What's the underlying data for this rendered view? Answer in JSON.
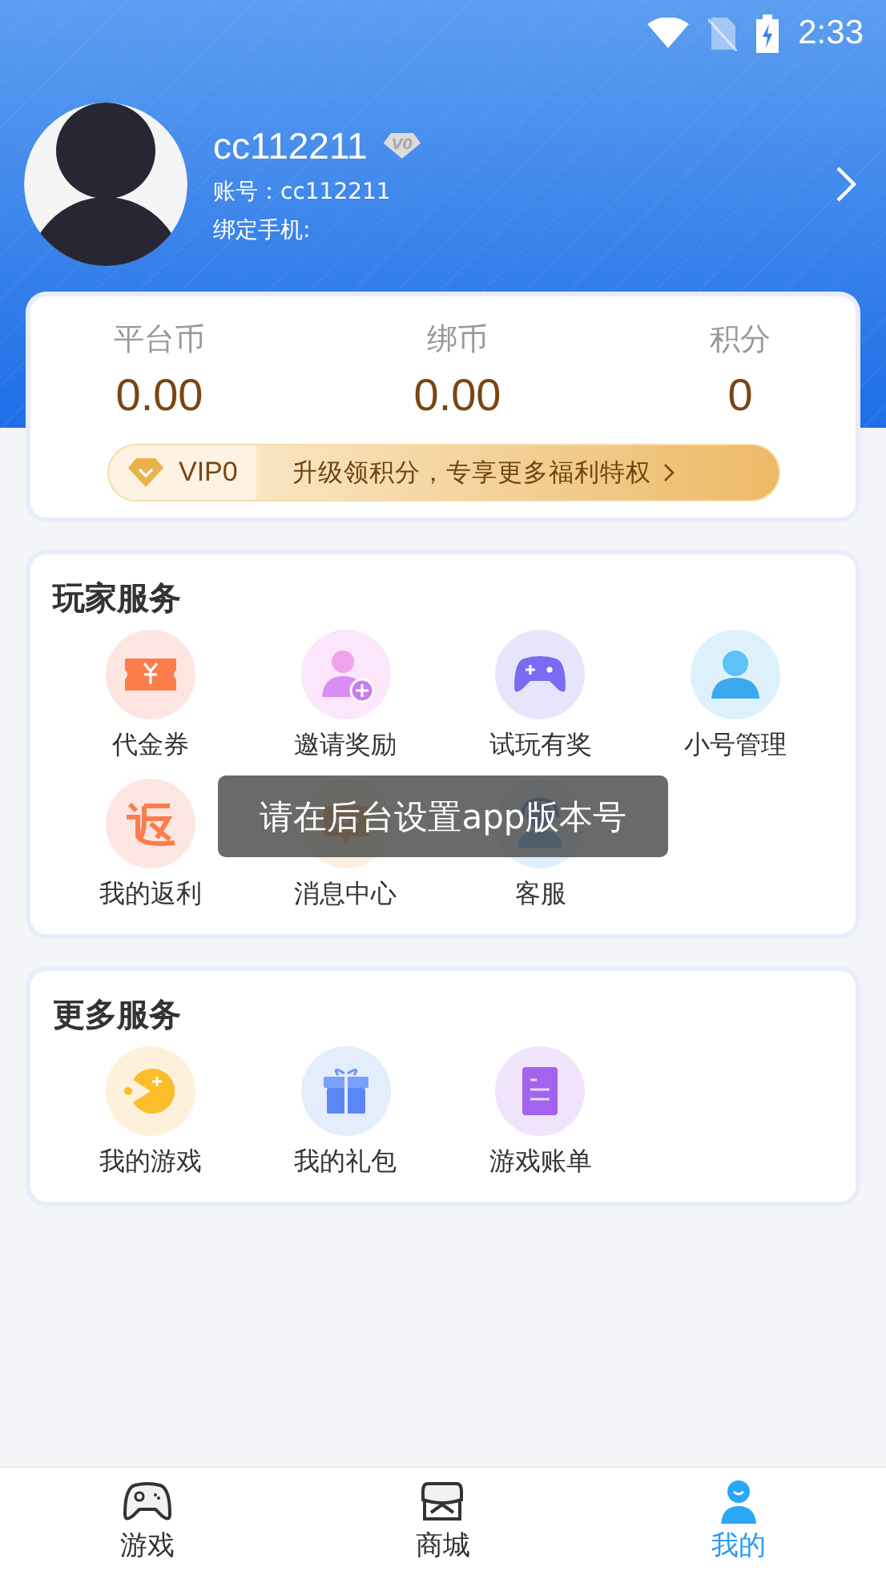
{
  "status_bar": {
    "time": "2:33"
  },
  "profile": {
    "username": "cc112211",
    "level_badge": "V0",
    "account": "账号：cc112211",
    "phone": "绑定手机:"
  },
  "balances": [
    {
      "label": "平台币",
      "value": "0.00"
    },
    {
      "label": "绑币",
      "value": "0.00"
    },
    {
      "label": "积分",
      "value": "0"
    }
  ],
  "vip": {
    "level": "VIP0",
    "promo": "升级领积分，专享更多福利特权"
  },
  "sections": [
    {
      "title": "玩家服务",
      "items": [
        "代金券",
        "邀请奖励",
        "试玩有奖",
        "小号管理",
        "我的返利",
        "消息中心",
        "客服"
      ]
    },
    {
      "title": "更多服务",
      "items": [
        "我的游戏",
        "我的礼包",
        "游戏账单"
      ]
    }
  ],
  "toast": "请在后台设置app版本号",
  "tabs": [
    {
      "label": "游戏",
      "selected": false
    },
    {
      "label": "商城",
      "selected": false
    },
    {
      "label": "我的",
      "selected": true
    }
  ]
}
